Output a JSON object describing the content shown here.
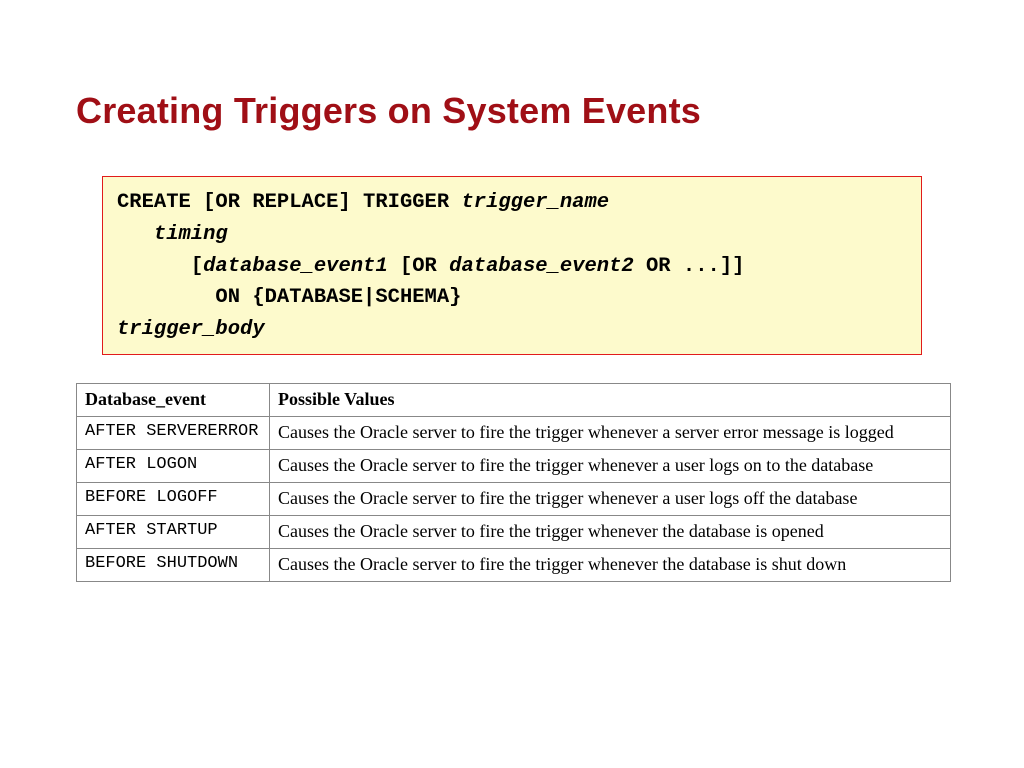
{
  "title": "Creating Triggers on System Events",
  "code": {
    "l1a": "CREATE [OR REPLACE] TRIGGER ",
    "l1b": "trigger_name",
    "l2": "timing",
    "l3a": "[",
    "l3b": "database_event1",
    "l3c": " [OR ",
    "l3d": "database_event2",
    "l3e": " OR ...]]",
    "l4": "ON {DATABASE|SCHEMA}",
    "l5": "trigger_body"
  },
  "table": {
    "head": {
      "c1": "Database_event",
      "c2": "Possible Values"
    },
    "rows": {
      "r0": {
        "evt": "AFTER SERVERERROR",
        "desc": "Causes the Oracle server to fire the trigger whenever a server error message is logged"
      },
      "r1": {
        "evt": "AFTER LOGON",
        "desc": "Causes the Oracle server to fire the trigger whenever a user logs on to the database"
      },
      "r2": {
        "evt": "BEFORE LOGOFF",
        "desc": "Causes the Oracle server to fire the trigger whenever a user logs off the database"
      },
      "r3": {
        "evt": "AFTER STARTUP",
        "desc": "Causes the Oracle server to fire the trigger whenever the database is opened"
      },
      "r4": {
        "evt": "BEFORE SHUTDOWN",
        "desc": "Causes the Oracle server to fire the trigger whenever the database is shut down"
      }
    }
  }
}
